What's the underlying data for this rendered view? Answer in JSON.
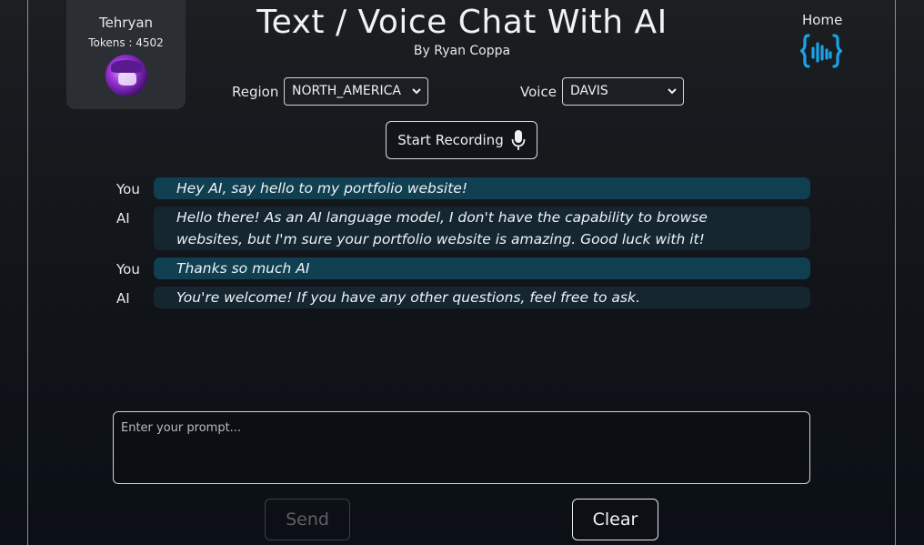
{
  "user": {
    "name": "Tehryan",
    "tokens": "Tokens : 4502",
    "avatar_icon": "avatar-image"
  },
  "header": {
    "title": "Text / Voice Chat With AI",
    "subtitle": "By Ryan Coppa",
    "home_label": "Home",
    "home_icon": "code-waveform-icon",
    "accent_color": "#1aa3e8"
  },
  "controls": {
    "region_label": "Region",
    "region_value": "NORTH_AMERICA",
    "voice_label": "Voice",
    "voice_value": "DAVIS",
    "record_label": "Start Recording",
    "record_icon": "microphone-icon"
  },
  "messages": [
    {
      "speaker": "You",
      "text": "Hey AI, say hello to my portfolio website!"
    },
    {
      "speaker": "AI",
      "text": "Hello there! As an AI language model, I don't have the capability to browse websites, but I'm sure your portfolio website is amazing. Good luck with it!"
    },
    {
      "speaker": "You",
      "text": "Thanks so much AI"
    },
    {
      "speaker": "AI",
      "text": "You're welcome! If you have any other questions, feel free to ask."
    }
  ],
  "prompt": {
    "placeholder": "Enter your prompt...",
    "value": ""
  },
  "actions": {
    "send_label": "Send",
    "clear_label": "Clear"
  }
}
